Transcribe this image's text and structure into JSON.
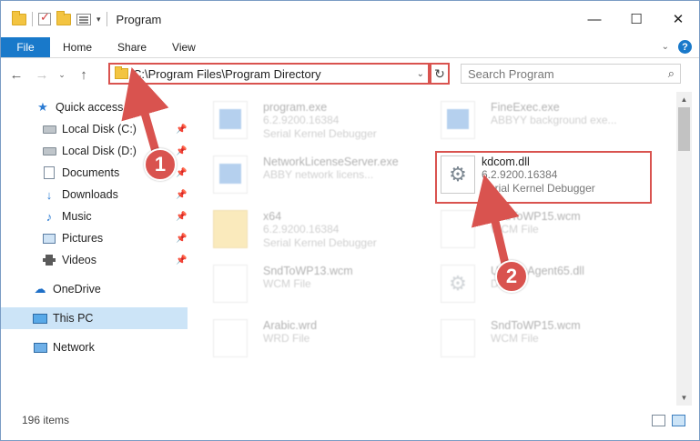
{
  "window": {
    "title": "Program",
    "buttons": {
      "minimize": "—",
      "maximize": "☐",
      "close": "✕"
    }
  },
  "ribbon": {
    "tabs": [
      "File",
      "Home",
      "Share",
      "View"
    ],
    "expand": "⌄",
    "help": "?"
  },
  "nav": {
    "back": "←",
    "forward": "→",
    "recent": "⌄",
    "up": "↑",
    "address": "C:\\Program Files\\Program Directory",
    "address_dropdown": "⌄",
    "refresh": "↻",
    "search_placeholder": "Search Program",
    "search_icon": "⌕"
  },
  "sidebar": {
    "items": [
      {
        "label": "Quick access",
        "icon": "star-icon",
        "pin": ""
      },
      {
        "label": "Local Disk (C:)",
        "icon": "disk-icon",
        "pin": "📌"
      },
      {
        "label": "Local Disk (D:)",
        "icon": "disk-icon",
        "pin": "📌"
      },
      {
        "label": "Documents",
        "icon": "documents-icon",
        "pin": "📌"
      },
      {
        "label": "Downloads",
        "icon": "downloads-icon",
        "pin": "📌"
      },
      {
        "label": "Music",
        "icon": "music-icon",
        "pin": "📌"
      },
      {
        "label": "Pictures",
        "icon": "pictures-icon",
        "pin": "📌"
      },
      {
        "label": "Videos",
        "icon": "videos-icon",
        "pin": "📌"
      },
      {
        "label": "OneDrive",
        "icon": "onedrive-icon",
        "pin": ""
      },
      {
        "label": "This PC",
        "icon": "this-pc-icon",
        "pin": ""
      },
      {
        "label": "Network",
        "icon": "network-icon",
        "pin": ""
      }
    ]
  },
  "files": [
    {
      "name": "program.exe",
      "line1": "6.2.9200.16384",
      "line2": "Serial Kernel Debugger",
      "icon": "exe-icon"
    },
    {
      "name": "FineExec.exe",
      "line1": "ABBYY background exe...",
      "line2": "",
      "icon": "exe-icon"
    },
    {
      "name": "NetworkLicenseServer.exe",
      "line1": "ABBY network licens...",
      "line2": "",
      "icon": "exe-icon"
    },
    {
      "name": "kdcom.dll",
      "line1": "6.2.9200.16384",
      "line2": "Serial Kernel Debugger",
      "icon": "gear-file-icon"
    },
    {
      "name": "x64",
      "line1": "6.2.9200.16384",
      "line2": "Serial Kernel Debugger",
      "icon": "folder-icon"
    },
    {
      "name": "SndToWP15.wcm",
      "line1": "WCM File",
      "line2": "",
      "icon": "file-icon"
    },
    {
      "name": "SndToWP13.wcm",
      "line1": "WCM File",
      "line2": "",
      "icon": "file-icon"
    },
    {
      "name": "UpdateAgent65.dll",
      "line1": "DLL",
      "line2": "",
      "icon": "gear-file-icon"
    },
    {
      "name": "Arabic.wrd",
      "line1": "WRD File",
      "line2": "",
      "icon": "file-icon"
    },
    {
      "name": "SndToWP15.wcm",
      "line1": "WCM File",
      "line2": "",
      "icon": "file-icon"
    }
  ],
  "status": {
    "item_count": "196 items"
  },
  "annotations": {
    "step1": "1",
    "step2": "2",
    "color": "#d9534f"
  }
}
